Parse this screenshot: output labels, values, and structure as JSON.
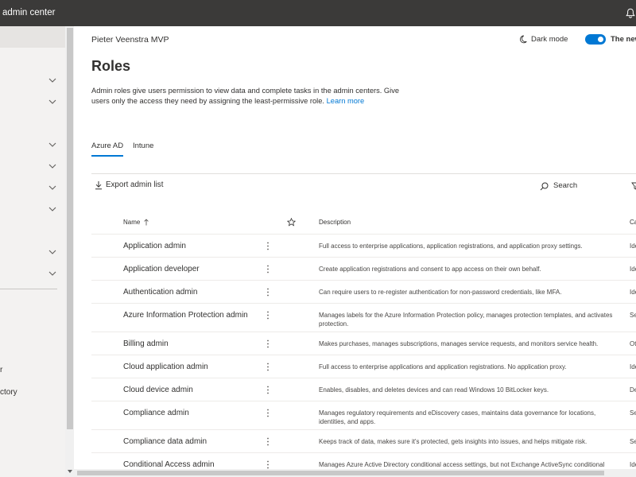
{
  "app": {
    "title": "admin center"
  },
  "sidebar": {
    "item_labels": [
      "r",
      "ctory"
    ]
  },
  "page": {
    "user": "Pieter Veenstra MVP",
    "dark_mode_label": "Dark mode",
    "new_admin_label": "The new",
    "new_admin_toggle_on": true,
    "title": "Roles",
    "description": "Admin roles give users permission to view data and complete tasks in the admin centers. Give users only the access they need by assigning the least-permissive role.",
    "learn_more": "Learn more"
  },
  "tabs": [
    {
      "label": "Azure AD",
      "selected": true
    },
    {
      "label": "Intune",
      "selected": false
    }
  ],
  "toolbar": {
    "export_label": "Export admin list",
    "search_label": "Search"
  },
  "table": {
    "columns": {
      "name": "Name",
      "description": "Description",
      "category": "Ca"
    },
    "sort": {
      "column": "name",
      "direction": "ascending"
    },
    "rows": [
      {
        "name": "Application admin",
        "description": "Full access to enterprise applications, application registrations, and application proxy settings.",
        "category": "Ide"
      },
      {
        "name": "Application developer",
        "description": "Create application registrations and consent to app access on their own behalf.",
        "category": "Ide"
      },
      {
        "name": "Authentication admin",
        "description": "Can require users to re-register authentication for non-password credentials, like MFA.",
        "category": "Ide"
      },
      {
        "name": "Azure Information Protection admin",
        "description": "Manages labels for the Azure Information Protection policy, manages protection templates, and activates protection.",
        "category": "Se"
      },
      {
        "name": "Billing admin",
        "description": "Makes purchases, manages subscriptions, manages service requests, and monitors service health.",
        "category": "Ot"
      },
      {
        "name": "Cloud application admin",
        "description": "Full access to enterprise applications and application registrations. No application proxy.",
        "category": "Ide"
      },
      {
        "name": "Cloud device admin",
        "description": "Enables, disables, and deletes devices and can read Windows 10 BitLocker keys.",
        "category": "De"
      },
      {
        "name": "Compliance admin",
        "description": "Manages regulatory requirements and eDiscovery cases, maintains data governance for locations, identities, and apps.",
        "category": "Se"
      },
      {
        "name": "Compliance data admin",
        "description": "Keeps track of data, makes sure it's protected, gets insights into issues, and helps mitigate risk.",
        "category": "Se"
      },
      {
        "name": "Conditional Access admin",
        "description": "Manages Azure Active Directory conditional access settings, but not Exchange ActiveSync conditional",
        "category": "Ide"
      }
    ]
  },
  "icons": {
    "notifications": "bell-icon",
    "nav_group": "chevron-down-icon",
    "dark_mode": "moon-icon",
    "export": "download-icon",
    "search": "search-icon",
    "filter": "filter-icon",
    "sort": "sort-ascending-icon",
    "favorite": "star-icon",
    "row_actions": "more-options-icon"
  },
  "colors": {
    "topbar": "#3b3a39",
    "accent": "#0078d4",
    "text": "#323130",
    "sidebar": "#f3f2f1"
  }
}
